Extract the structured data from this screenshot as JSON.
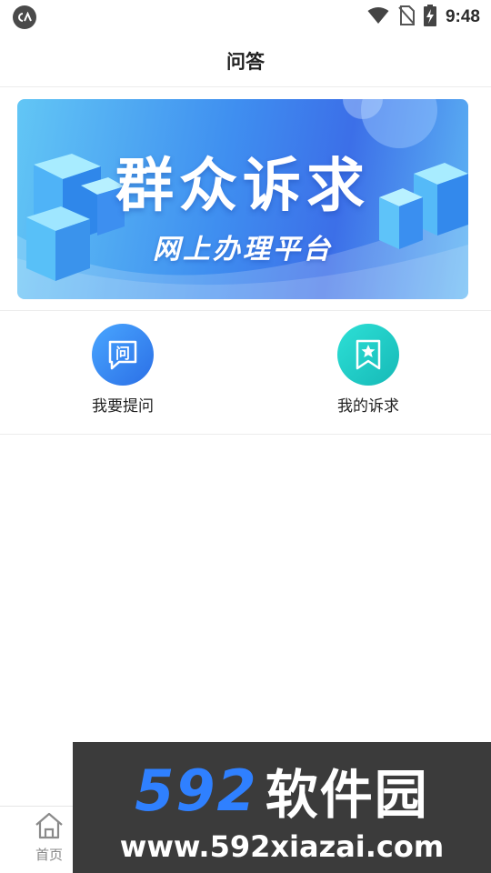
{
  "status_bar": {
    "time": "9:48",
    "icons": [
      "app-badge-icon",
      "wifi-icon",
      "no-sim-icon",
      "battery-charging-icon"
    ]
  },
  "header": {
    "title": "问答"
  },
  "banner": {
    "title": "群众诉求",
    "subtitle": "网上办理平台"
  },
  "actions": [
    {
      "label": "我要提问",
      "icon": "ask-question-icon",
      "icon_text": "问",
      "color": "#2b7bf0"
    },
    {
      "label": "我的诉求",
      "icon": "star-bookmark-icon",
      "color": "#1cc7c2"
    }
  ],
  "bottom_nav": {
    "items": [
      {
        "label": "首页",
        "icon": "home-icon"
      }
    ]
  },
  "watermark": {
    "logo_number": "592",
    "logo_text": "软件园",
    "url": "www.592xiazai.com"
  }
}
